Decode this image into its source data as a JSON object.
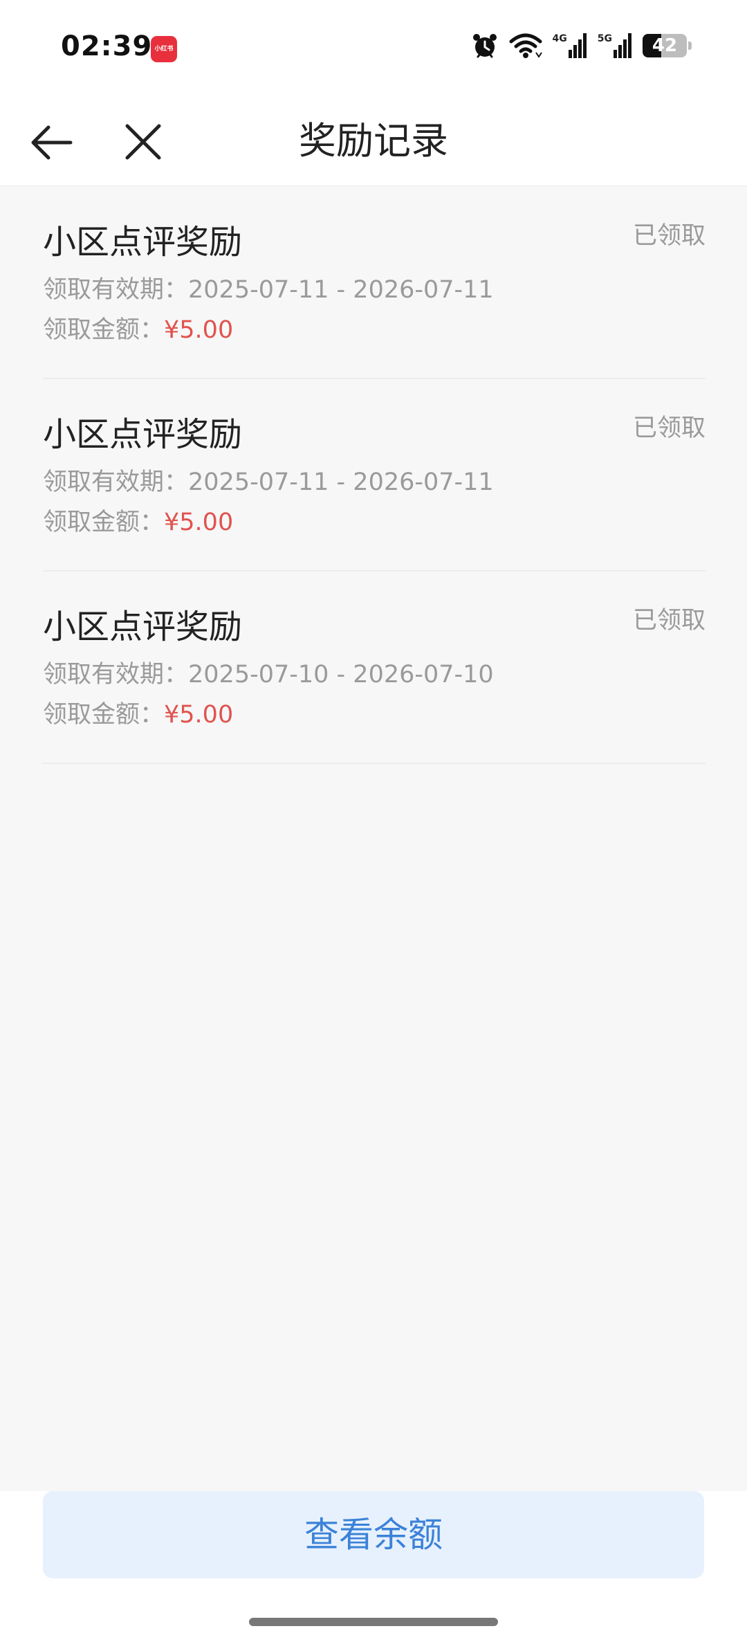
{
  "status_bar": {
    "time": "02:39",
    "app_badge": "小红书",
    "battery_level": "42",
    "battery_fraction": 0.42,
    "net_4g": "4G",
    "net_5g": "5G"
  },
  "nav": {
    "title": "奖励记录"
  },
  "records": [
    {
      "title": "小区点评奖励",
      "status": "已领取",
      "validity_label": "领取有效期：",
      "validity_value": "2025-07-11 - 2026-07-11",
      "amount_label": "领取金额：",
      "amount_value": "¥5.00"
    },
    {
      "title": "小区点评奖励",
      "status": "已领取",
      "validity_label": "领取有效期：",
      "validity_value": "2025-07-11 - 2026-07-11",
      "amount_label": "领取金额：",
      "amount_value": "¥5.00"
    },
    {
      "title": "小区点评奖励",
      "status": "已领取",
      "validity_label": "领取有效期：",
      "validity_value": "2025-07-10 - 2026-07-10",
      "amount_label": "领取金额：",
      "amount_value": "¥5.00"
    }
  ],
  "footer": {
    "balance_button_label": "查看余额"
  },
  "colors": {
    "accent_blue": "#3c82d8",
    "button_bg": "#e7f1fd",
    "amount_red": "#e0534f",
    "badge_red": "#e8303d"
  }
}
